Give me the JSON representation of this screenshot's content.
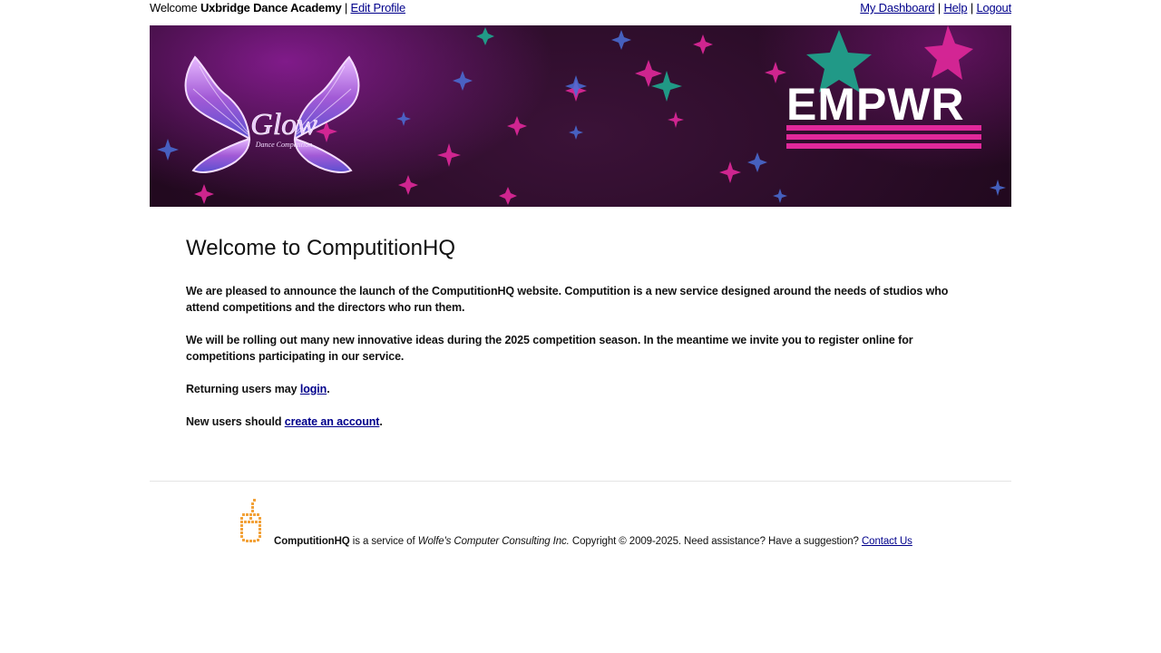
{
  "topbar": {
    "welcome_prefix": "Welcome",
    "studio_name": "Uxbridge Dance Academy",
    "separator": "|",
    "edit_profile": "Edit Profile",
    "dashboard": "My Dashboard",
    "help": "Help",
    "logout": "Logout"
  },
  "banner": {
    "left_logo_text": "Glow",
    "left_logo_subtext": "Dance Competition",
    "right_logo_text": "EMPWR",
    "colors": {
      "background": "#2a0b27",
      "accent_pink": "#e0289a",
      "accent_teal": "#1ea98f",
      "wing_purple": "#9b59d0"
    }
  },
  "main": {
    "title": "Welcome to ComputitionHQ",
    "paragraph1": "We are pleased to announce the launch of the ComputitionHQ website. Computition is a new service designed around the needs of studios who attend competitions and the directors who run them.",
    "paragraph2": "We will be rolling out many new innovative ideas during the 2025 competition season. In the meantime we invite you to register online for competitions participating in our service.",
    "returning_prefix": "Returning users may",
    "login_link": "login",
    "returning_suffix": ".",
    "new_prefix": "New users should",
    "create_link": "create an account",
    "new_suffix": "."
  },
  "footer": {
    "brand": "ComputitionHQ",
    "service_of": "is a service of",
    "company": "Wolfe's Computer Consulting Inc.",
    "copyright": "Copyright © 2009-2025. Need assistance? Have a suggestion?",
    "contact": "Contact Us",
    "mouse_icon": "computer-mouse-icon",
    "mouse_color": "#f2a23a"
  }
}
